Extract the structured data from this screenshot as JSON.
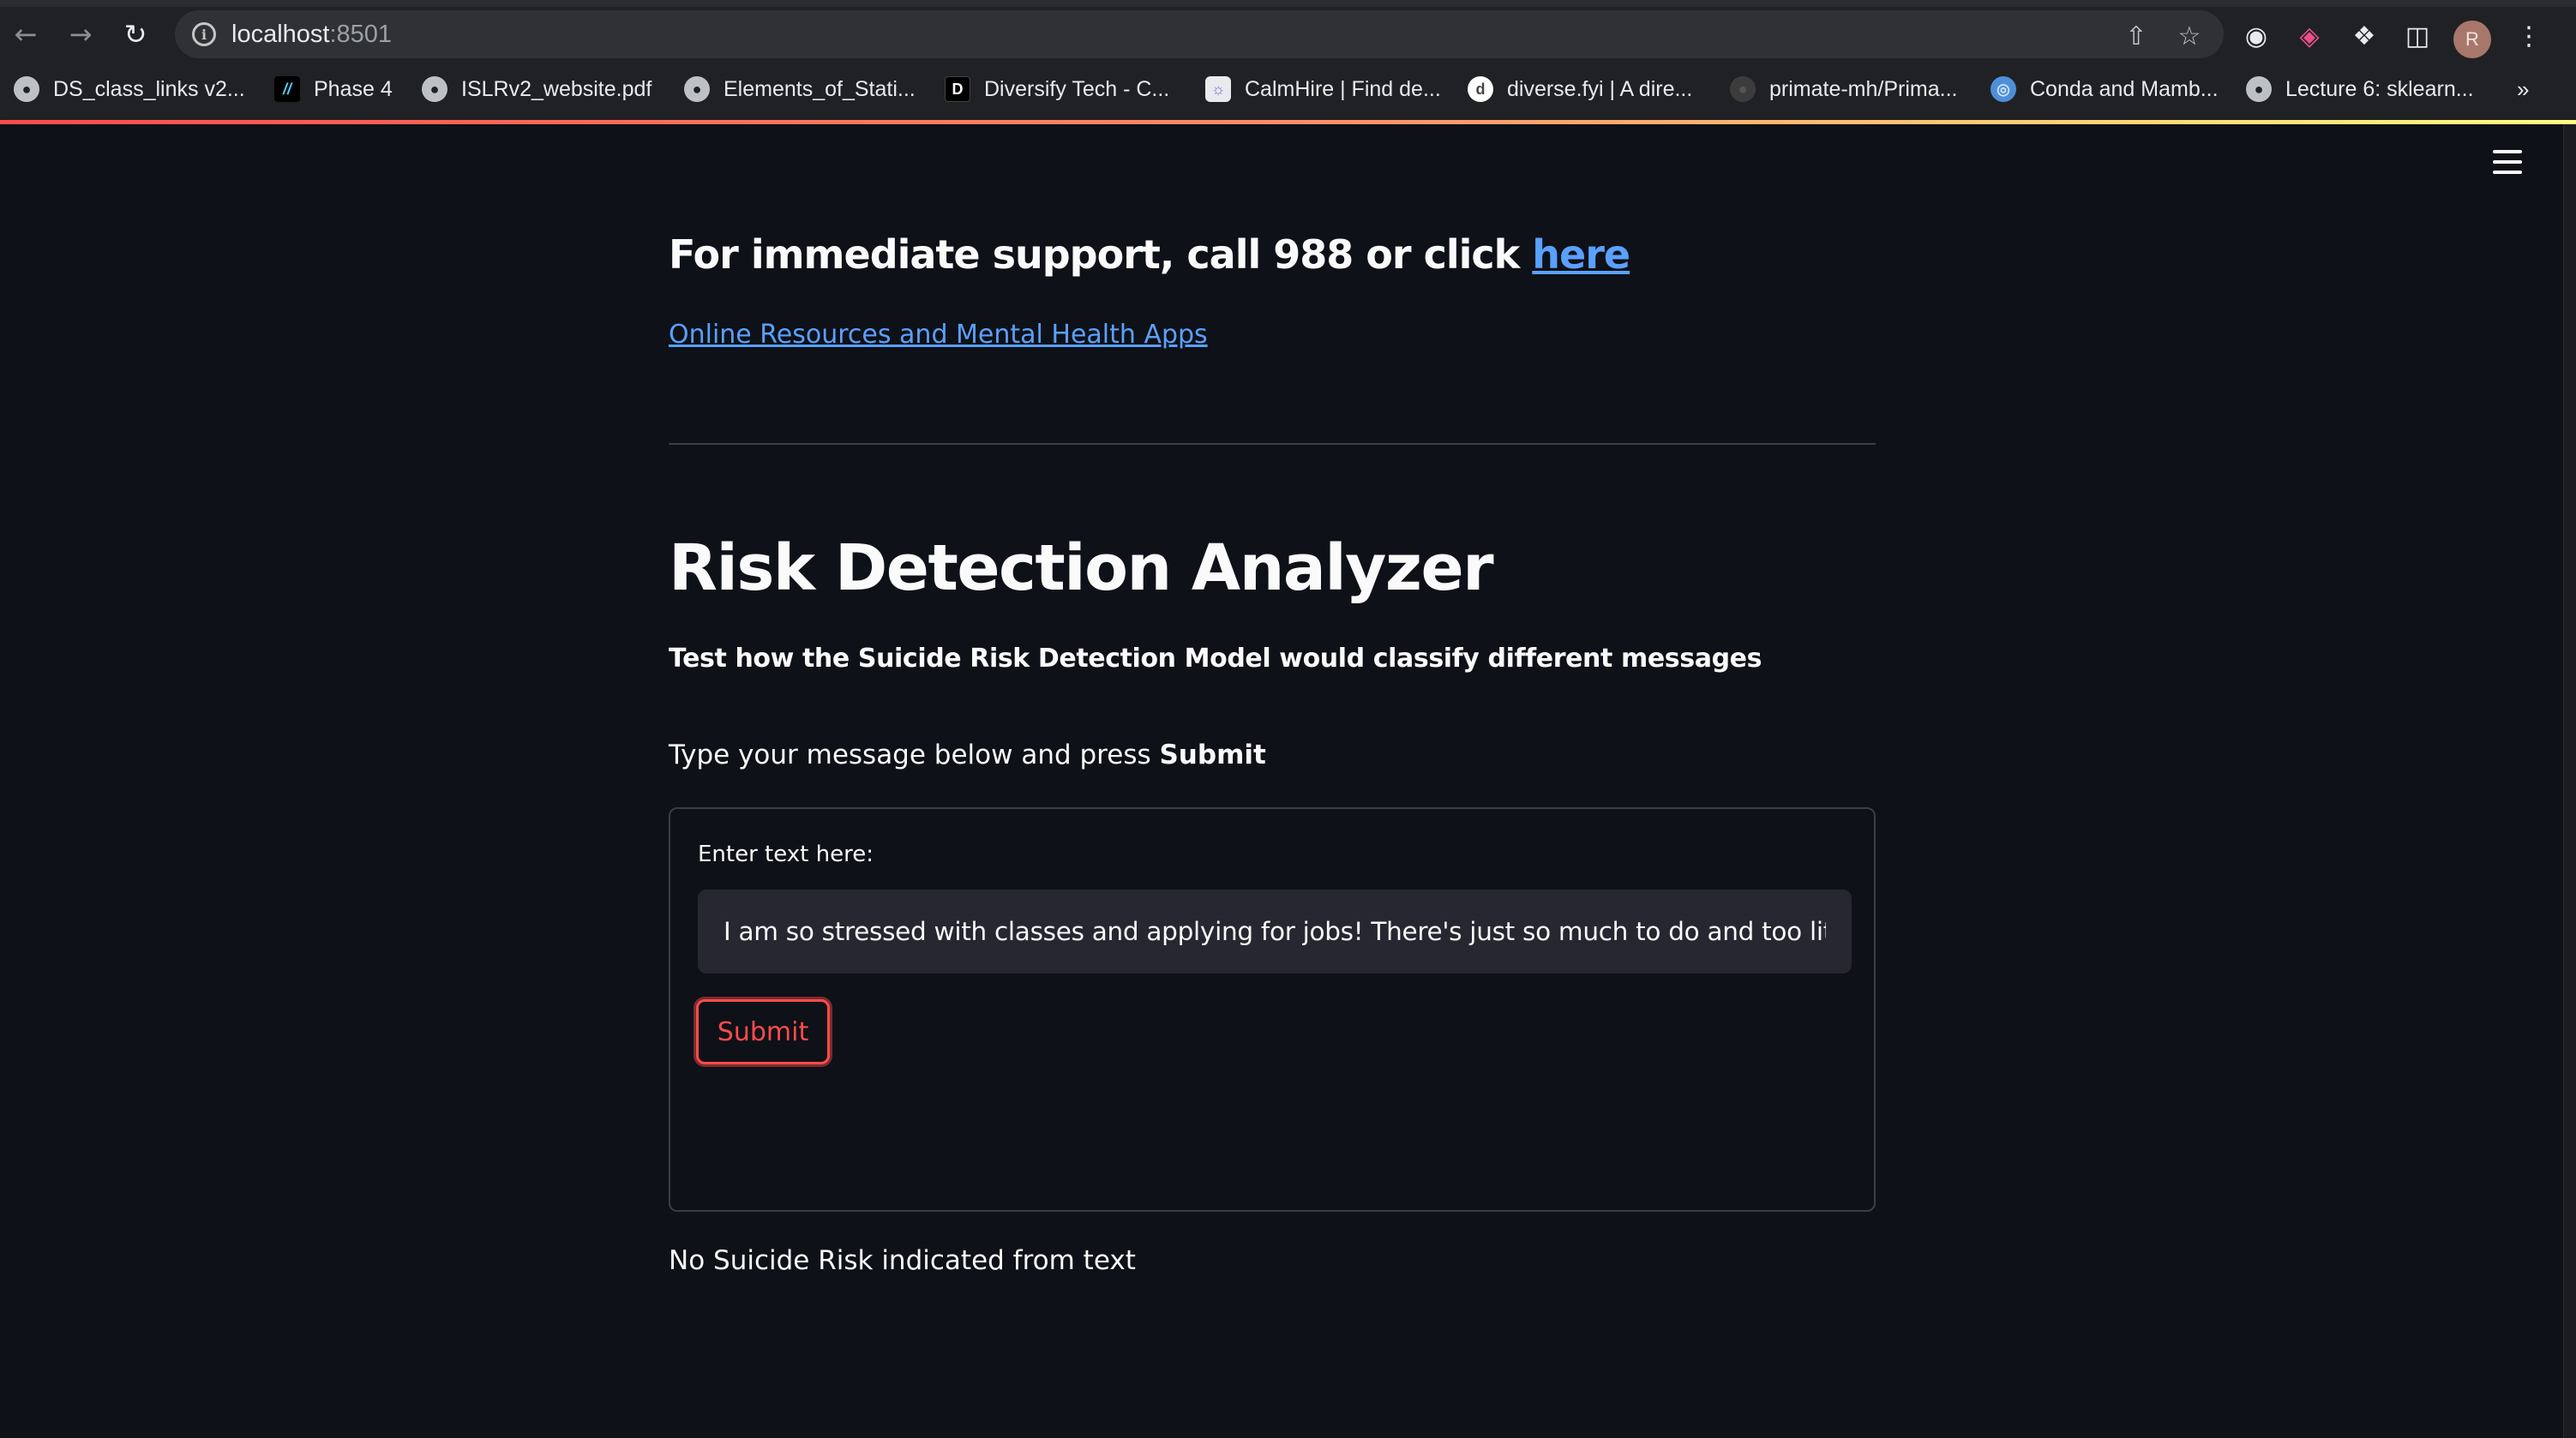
{
  "browser": {
    "url_host": "localhost",
    "url_port": ":8501",
    "avatar_letter": "R",
    "bookmarks": [
      {
        "label": "DS_class_links v2...",
        "icon": "globe-icon"
      },
      {
        "label": "Phase 4",
        "icon": "double-slash-icon"
      },
      {
        "label": "ISLRv2_website.pdf",
        "icon": "globe-icon"
      },
      {
        "label": "Elements_of_Stati...",
        "icon": "globe-icon"
      },
      {
        "label": "Diversify Tech - C...",
        "icon": "letter-d-icon"
      },
      {
        "label": "CalmHire | Find de...",
        "icon": "calmhire-icon"
      },
      {
        "label": "diverse.fyi | A dire...",
        "icon": "diverse-icon"
      },
      {
        "label": "primate-mh/Prima...",
        "icon": "github-icon"
      },
      {
        "label": "Conda and Mamb...",
        "icon": "world-icon"
      },
      {
        "label": "Lecture 6: sklearn...",
        "icon": "globe-icon"
      }
    ],
    "overflow_label": "»"
  },
  "app": {
    "support_prefix": "For immediate support, call 988 or click ",
    "support_link": "here",
    "resources_link": "Online Resources and Mental Health Apps",
    "title": "Risk Detection Analyzer",
    "subtitle": "Test how the Suicide Risk Detection Model would classify different messages",
    "instruction_prefix": "Type your message below and press ",
    "instruction_bold": "Submit",
    "input_label": "Enter text here:",
    "input_value": "I am so stressed with classes and applying for jobs! There's just so much to do and too little time!",
    "submit_label": "Submit",
    "result": "No Suicide Risk indicated from text"
  },
  "colors": {
    "background": "#0e1117",
    "text": "#fafafa",
    "link": "#5aa0ff",
    "primary": "#ff4b4b",
    "input_bg": "#262730"
  }
}
